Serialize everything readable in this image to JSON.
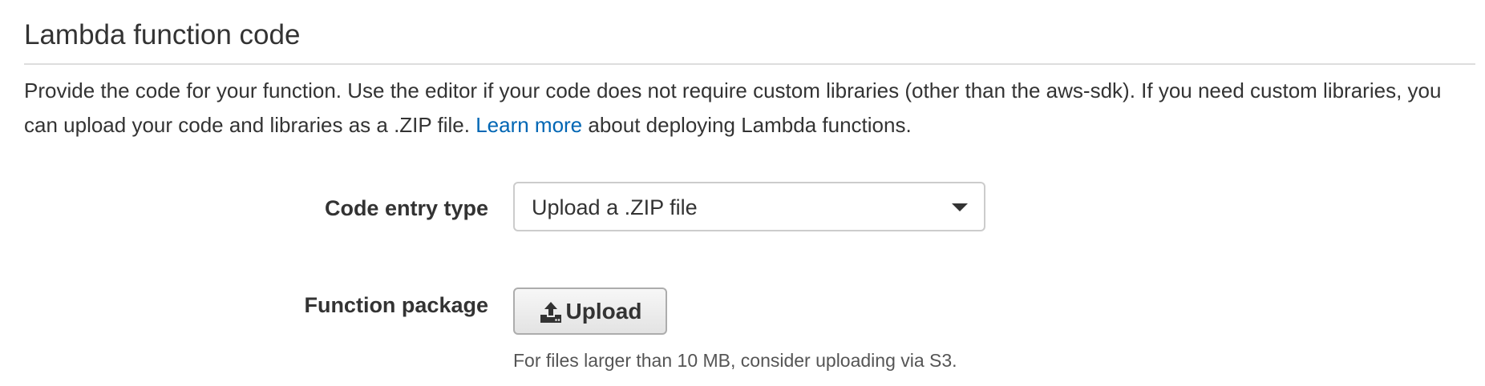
{
  "section": {
    "title": "Lambda function code",
    "description_before_link": "Provide the code for your function. Use the editor if your code does not require custom libraries (other than the aws-sdk). If you need custom libraries, you can upload your code and libraries as a .ZIP file. ",
    "link_text": "Learn more",
    "description_after_link": " about deploying Lambda functions."
  },
  "code_entry": {
    "label": "Code entry type",
    "selected_value": "Upload a .ZIP file"
  },
  "function_package": {
    "label": "Function package",
    "upload_button_label": "Upload",
    "upload_icon": "upload-icon",
    "help_text": "For files larger than 10 MB, consider uploading via S3."
  },
  "colors": {
    "link": "#0066b4",
    "text": "#333333",
    "divider": "#dddddd"
  }
}
